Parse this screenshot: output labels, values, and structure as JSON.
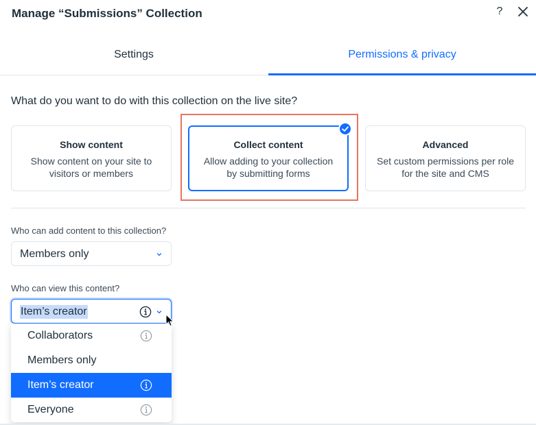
{
  "dialog": {
    "title": "Manage “Submissions” Collection",
    "help_label": "?",
    "close_icon": "close-icon"
  },
  "tabs": [
    {
      "label": "Settings",
      "active": false
    },
    {
      "label": "Permissions & privacy",
      "active": true
    }
  ],
  "question": "What do you want to do with this collection on the live site?",
  "cards": [
    {
      "title": "Show content",
      "desc_line1": "Show content on your site to",
      "desc_line2": "visitors or members",
      "selected": false
    },
    {
      "title": "Collect content",
      "desc_line1": "Allow adding to your collection",
      "desc_line2": "by submitting forms",
      "selected": true
    },
    {
      "title": "Advanced",
      "desc_line1": "Set custom permissions per role",
      "desc_line2": "for the site and CMS",
      "selected": false
    }
  ],
  "add_content": {
    "label": "Who can add content to this collection?",
    "value": "Members only"
  },
  "view_content": {
    "label": "Who can view this content?",
    "value": "Item’s creator",
    "options": [
      {
        "label": "Collaborators",
        "info": true,
        "selected": false
      },
      {
        "label": "Members only",
        "info": false,
        "selected": false
      },
      {
        "label": "Item’s creator",
        "info": true,
        "selected": true
      },
      {
        "label": "Everyone",
        "info": true,
        "selected": false
      }
    ]
  },
  "colors": {
    "accent": "#116dff",
    "highlight": "#e8735e",
    "text": "#20303c",
    "border": "#dfe5eb"
  }
}
